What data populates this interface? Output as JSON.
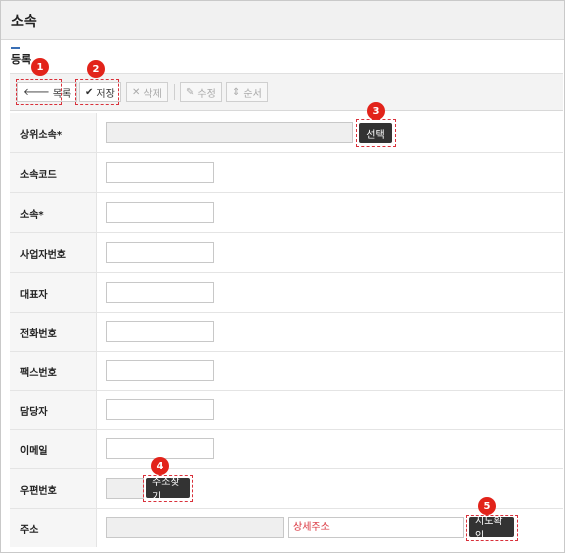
{
  "header": {
    "title": "소속"
  },
  "subtitle": "등록",
  "toolbar": {
    "list_label": "목록",
    "save_label": "저장",
    "delete_label": "삭제",
    "edit_label": "수정",
    "order_label": "순서"
  },
  "badges": [
    "1",
    "2",
    "3",
    "4",
    "5"
  ],
  "form": {
    "parent_label": "상위소속",
    "required_mark": "*",
    "select_label": "선택",
    "code_label": "소속코드",
    "name_label": "소속",
    "biz_label": "사업자번호",
    "ceo_label": "대표자",
    "phone_label": "전화번호",
    "fax_label": "팩스번호",
    "manager_label": "담당자",
    "email_label": "이메일",
    "zip_label": "우편번호",
    "zip_button": "주소찾기",
    "address_label": "주소",
    "detail_placeholder": "상세주소",
    "map_button": "지도확인"
  },
  "colors": {
    "accent": "#e2231a",
    "header_bg": "#f1f1f1",
    "dark_button": "#333333"
  },
  "icons": [
    "back-arrow-icon",
    "check-icon",
    "x-icon",
    "pencil-icon",
    "sort-arrows-icon"
  ]
}
